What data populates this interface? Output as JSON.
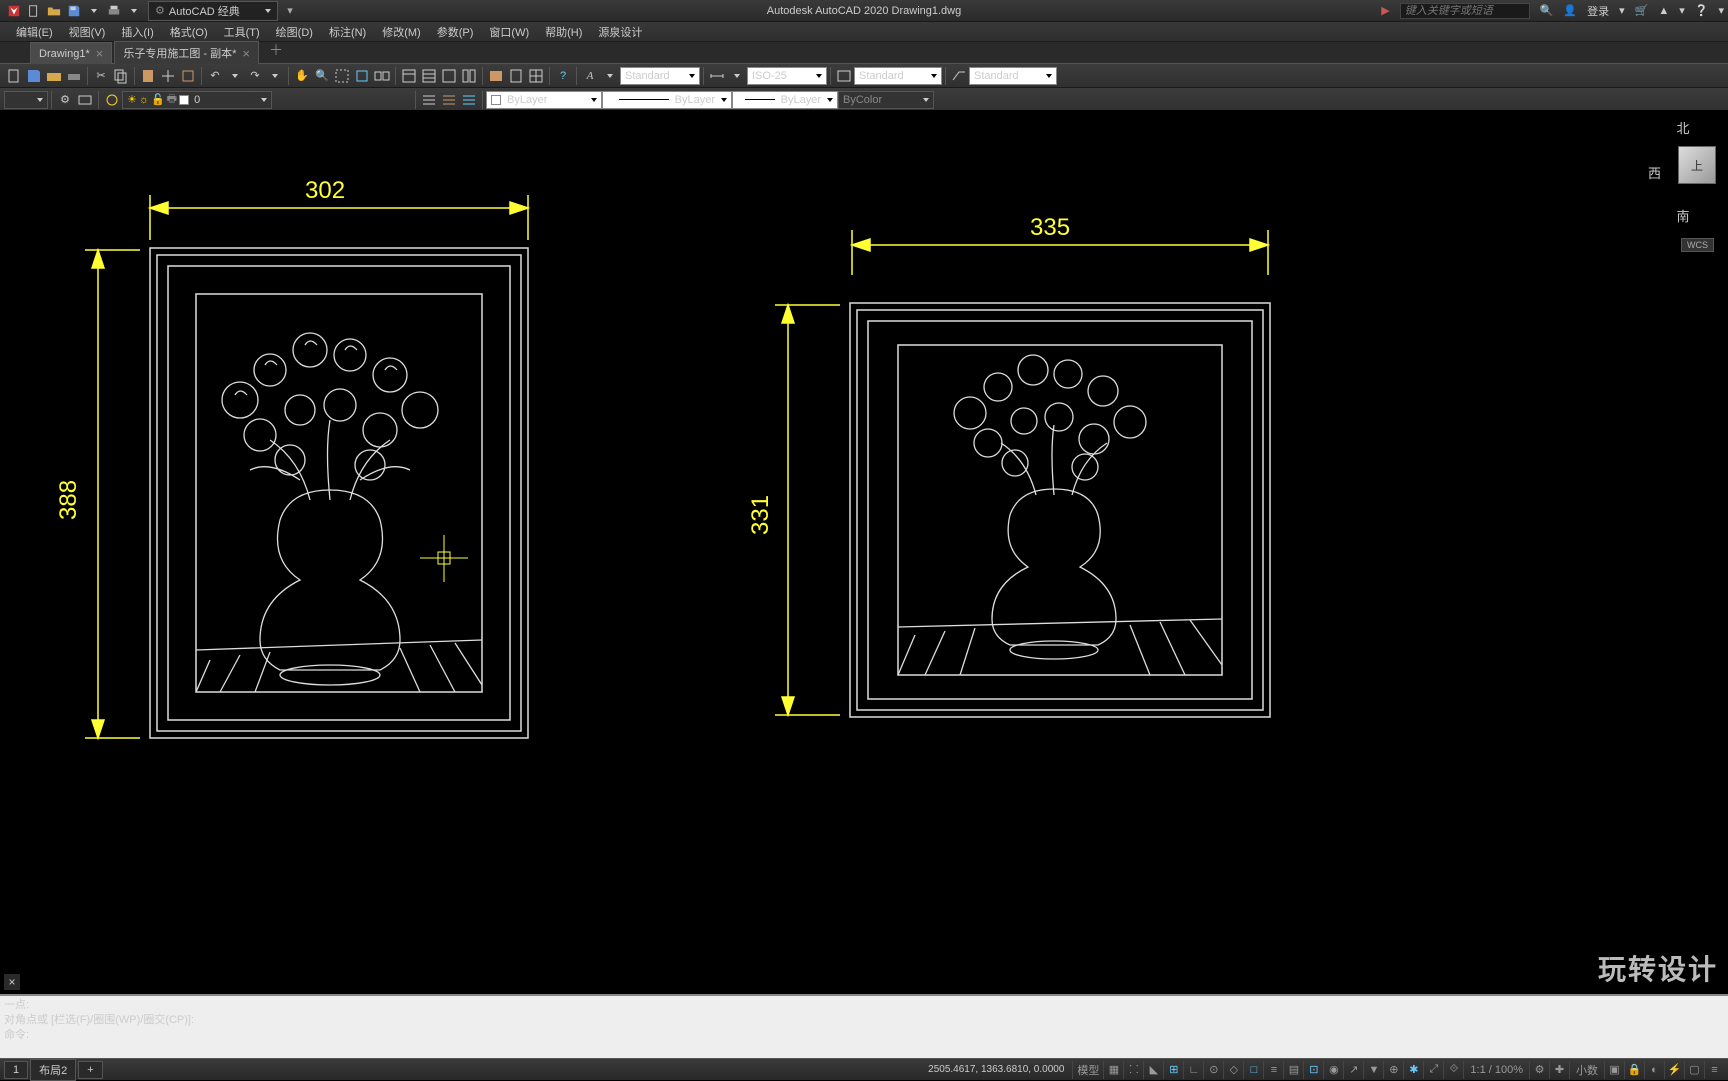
{
  "titlebar": {
    "workspace_label": "AutoCAD 经典",
    "app_title": "Autodesk AutoCAD 2020    Drawing1.dwg",
    "search_placeholder": "键入关键字或短语",
    "login_label": "登录"
  },
  "menus": [
    "编辑(E)",
    "视图(V)",
    "插入(I)",
    "格式(O)",
    "工具(T)",
    "绘图(D)",
    "标注(N)",
    "修改(M)",
    "参数(P)",
    "窗口(W)",
    "帮助(H)",
    "源泉设计"
  ],
  "tabs": [
    {
      "label": "Drawing1*",
      "active": true
    },
    {
      "label": "乐子专用施工图 - 副本*",
      "active": false
    }
  ],
  "tool_selects": {
    "text_style": "Standard",
    "dim_style": "ISO-25",
    "table_style": "Standard",
    "mleader_style": "Standard",
    "layer_color": "ByLayer",
    "linetype": "ByLayer",
    "lineweight": "ByLayer",
    "plot_style": "ByColor",
    "layer_name": "0"
  },
  "viewcube": {
    "n": "北",
    "w": "西",
    "s": "南",
    "top": "上",
    "wcs": "WCS"
  },
  "drawing": {
    "frame1": {
      "width_dim": "302",
      "height_dim": "388"
    },
    "frame2": {
      "width_dim": "335",
      "height_dim": "331"
    }
  },
  "watermark": "玩转设计",
  "command": {
    "line1": "一点:",
    "line2": "对角点或 [栏选(F)/圈围(WP)/圈交(CP)]:",
    "prompt": "命令:"
  },
  "status": {
    "layout_tabs": [
      "1",
      "布局2"
    ],
    "coords": "2505.4617, 1363.6810, 0.0000",
    "model": "模型",
    "scale": "1:1 / 100%",
    "decimal": "小数"
  }
}
